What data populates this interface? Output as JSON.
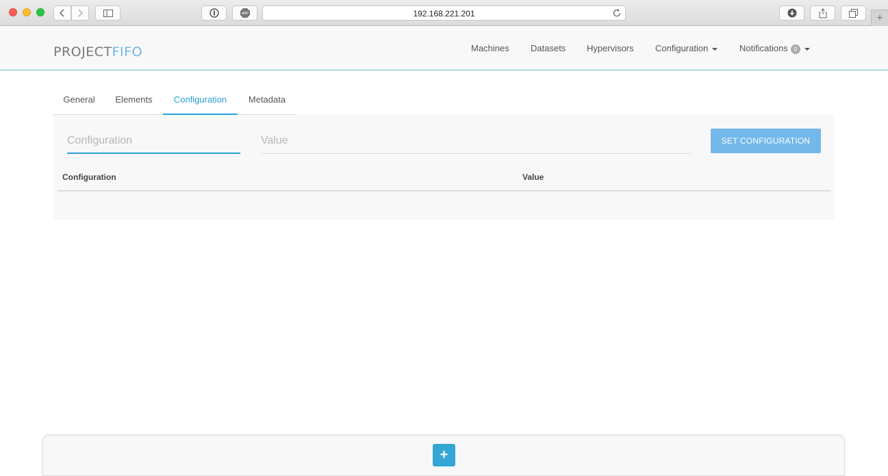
{
  "browser": {
    "url": "192.168.221.201"
  },
  "navbar": {
    "logo_part1": "PROJECT",
    "logo_part2": "FIFO",
    "items": [
      {
        "label": "Machines"
      },
      {
        "label": "Datasets"
      },
      {
        "label": "Hypervisors"
      },
      {
        "label": "Configuration"
      },
      {
        "label": "Notifications"
      }
    ],
    "notifications_count": "0"
  },
  "tabs": [
    {
      "label": "General"
    },
    {
      "label": "Elements"
    },
    {
      "label": "Configuration",
      "active": true
    },
    {
      "label": "Metadata"
    }
  ],
  "form": {
    "config_placeholder": "Configuration",
    "value_placeholder": "Value",
    "set_button": "SET CONFIGURATION"
  },
  "table": {
    "columns": [
      "Configuration",
      "Value"
    ],
    "rows": []
  },
  "bottom": {
    "add_symbol": "+"
  },
  "colors": {
    "accent": "#2a9fd6",
    "button": "#74b8ea",
    "add_button": "#35a6d3"
  }
}
